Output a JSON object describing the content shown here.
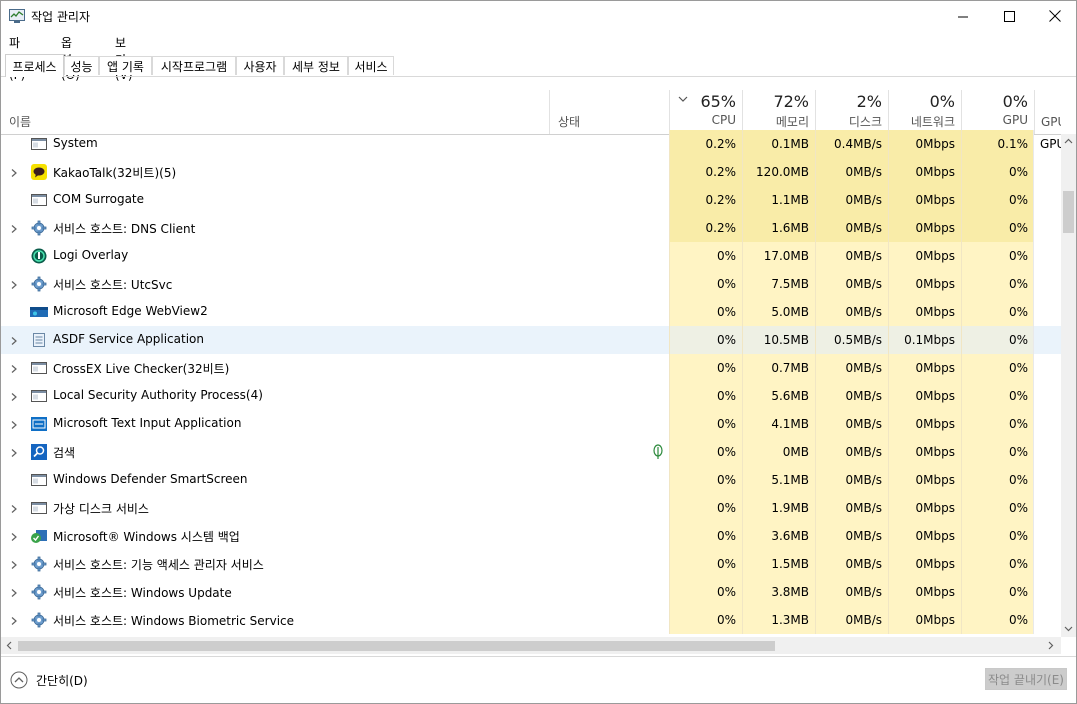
{
  "window": {
    "title": "작업 관리자"
  },
  "menu": [
    "파일(F)",
    "옵션(O)",
    "보기(V)"
  ],
  "tabs": [
    "프로세스",
    "성능",
    "앱 기록",
    "시작프로그램",
    "사용자",
    "세부 정보",
    "서비스"
  ],
  "columns": {
    "name": "이름",
    "status": "상태",
    "cpu": {
      "pct": "65%",
      "label": "CPU"
    },
    "memory": {
      "pct": "72%",
      "label": "메모리"
    },
    "disk": {
      "pct": "2%",
      "label": "디스크"
    },
    "network": {
      "pct": "0%",
      "label": "네트워크"
    },
    "gpu": {
      "pct": "0%",
      "label": "GPU"
    },
    "gpu_engine": {
      "label": "GPU 엔"
    }
  },
  "processes": [
    {
      "name": "System",
      "expandable": false,
      "icon": "window-icon",
      "cpu": "0.2%",
      "memory": "0.1MB",
      "disk": "0.4MB/s",
      "network": "0Mbps",
      "gpu": "0.1%",
      "gpu_engine": "GPU",
      "highlight": true
    },
    {
      "name": "KakaoTalk(32비트)(5)",
      "expandable": true,
      "icon": "kakaotalk-icon",
      "cpu": "0.2%",
      "memory": "120.0MB",
      "disk": "0MB/s",
      "network": "0Mbps",
      "gpu": "0%",
      "gpu_engine": "",
      "highlight": true
    },
    {
      "name": "COM Surrogate",
      "expandable": false,
      "icon": "window-icon",
      "cpu": "0.2%",
      "memory": "1.1MB",
      "disk": "0MB/s",
      "network": "0Mbps",
      "gpu": "0%",
      "gpu_engine": "",
      "highlight": true
    },
    {
      "name": "서비스 호스트: DNS Client",
      "expandable": true,
      "icon": "gear-icon",
      "cpu": "0.2%",
      "memory": "1.6MB",
      "disk": "0MB/s",
      "network": "0Mbps",
      "gpu": "0%",
      "gpu_engine": "",
      "highlight": true
    },
    {
      "name": "Logi Overlay",
      "expandable": false,
      "icon": "logi-icon",
      "cpu": "0%",
      "memory": "17.0MB",
      "disk": "0MB/s",
      "network": "0Mbps",
      "gpu": "0%",
      "gpu_engine": "",
      "highlight": false
    },
    {
      "name": "서비스 호스트: UtcSvc",
      "expandable": true,
      "icon": "gear-icon",
      "cpu": "0%",
      "memory": "7.5MB",
      "disk": "0MB/s",
      "network": "0Mbps",
      "gpu": "0%",
      "gpu_engine": "",
      "highlight": false
    },
    {
      "name": "Microsoft Edge WebView2",
      "expandable": false,
      "icon": "edge-webview-icon",
      "cpu": "0%",
      "memory": "5.0MB",
      "disk": "0MB/s",
      "network": "0Mbps",
      "gpu": "0%",
      "gpu_engine": "",
      "highlight": false
    },
    {
      "name": "ASDF Service Application",
      "expandable": true,
      "icon": "document-icon",
      "cpu": "0%",
      "memory": "10.5MB",
      "disk": "0.5MB/s",
      "network": "0.1Mbps",
      "gpu": "0%",
      "gpu_engine": "",
      "highlight": false,
      "selected": true
    },
    {
      "name": "CrossEX Live Checker(32비트)",
      "expandable": true,
      "icon": "window-icon",
      "cpu": "0%",
      "memory": "0.7MB",
      "disk": "0MB/s",
      "network": "0Mbps",
      "gpu": "0%",
      "gpu_engine": "",
      "highlight": false
    },
    {
      "name": "Local Security Authority Process(4)",
      "expandable": true,
      "icon": "window-icon",
      "cpu": "0%",
      "memory": "5.6MB",
      "disk": "0MB/s",
      "network": "0Mbps",
      "gpu": "0%",
      "gpu_engine": "",
      "highlight": false
    },
    {
      "name": "Microsoft Text Input Application",
      "expandable": true,
      "icon": "text-input-icon",
      "cpu": "0%",
      "memory": "4.1MB",
      "disk": "0MB/s",
      "network": "0Mbps",
      "gpu": "0%",
      "gpu_engine": "",
      "highlight": false
    },
    {
      "name": "검색",
      "expandable": true,
      "icon": "search-icon",
      "cpu": "0%",
      "memory": "0MB",
      "disk": "0MB/s",
      "network": "0Mbps",
      "gpu": "0%",
      "gpu_engine": "",
      "highlight": false,
      "suspended": true
    },
    {
      "name": "Windows Defender SmartScreen",
      "expandable": false,
      "icon": "window-icon",
      "cpu": "0%",
      "memory": "5.1MB",
      "disk": "0MB/s",
      "network": "0Mbps",
      "gpu": "0%",
      "gpu_engine": "",
      "highlight": false
    },
    {
      "name": "가상 디스크 서비스",
      "expandable": true,
      "icon": "window-icon",
      "cpu": "0%",
      "memory": "1.9MB",
      "disk": "0MB/s",
      "network": "0Mbps",
      "gpu": "0%",
      "gpu_engine": "",
      "highlight": false
    },
    {
      "name": "Microsoft® Windows 시스템 백업",
      "expandable": true,
      "icon": "backup-icon",
      "cpu": "0%",
      "memory": "3.6MB",
      "disk": "0MB/s",
      "network": "0Mbps",
      "gpu": "0%",
      "gpu_engine": "",
      "highlight": false
    },
    {
      "name": "서비스 호스트: 기능 액세스 관리자 서비스",
      "expandable": true,
      "icon": "gear-icon",
      "cpu": "0%",
      "memory": "1.5MB",
      "disk": "0MB/s",
      "network": "0Mbps",
      "gpu": "0%",
      "gpu_engine": "",
      "highlight": false
    },
    {
      "name": "서비스 호스트: Windows Update",
      "expandable": true,
      "icon": "gear-icon",
      "cpu": "0%",
      "memory": "3.8MB",
      "disk": "0MB/s",
      "network": "0Mbps",
      "gpu": "0%",
      "gpu_engine": "",
      "highlight": false
    },
    {
      "name": "서비스 호스트: Windows Biometric Service",
      "expandable": true,
      "icon": "gear-icon",
      "cpu": "0%",
      "memory": "1.3MB",
      "disk": "0MB/s",
      "network": "0Mbps",
      "gpu": "0%",
      "gpu_engine": "",
      "highlight": false
    }
  ],
  "footer": {
    "less_details": "간단히(D)",
    "end_task": "작업 끝내기(E)"
  },
  "colors": {
    "cpu_high": "#f9eca8",
    "cpu_low": "#fff4c4",
    "selected_row": "#eaf3fb",
    "accent": "#0078d7"
  }
}
